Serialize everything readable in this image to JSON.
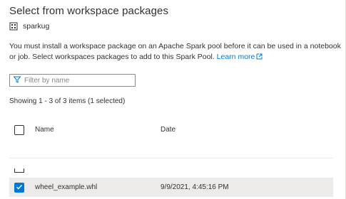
{
  "dialog": {
    "title": "Select from workspace packages",
    "pool_name": "sparkug",
    "description": "You must install a workspace package on an Apache Spark pool before it can be used in a notebook or job. Select workspaces packages to add to this Spark Pool.",
    "learn_more": "Learn more"
  },
  "filter": {
    "placeholder": "Filter by name",
    "value": ""
  },
  "status": {
    "showing": "Showing 1 - 3 of 3 items (1 selected)"
  },
  "table": {
    "columns": {
      "name": "Name",
      "date": "Date"
    },
    "rows": [
      {
        "name": "wheel_example.whl",
        "date": "9/9/2021, 4:45:16 PM",
        "selected": true
      }
    ]
  },
  "colors": {
    "accent": "#0078d4",
    "selected_row": "#edebe9",
    "text": "#323130"
  }
}
